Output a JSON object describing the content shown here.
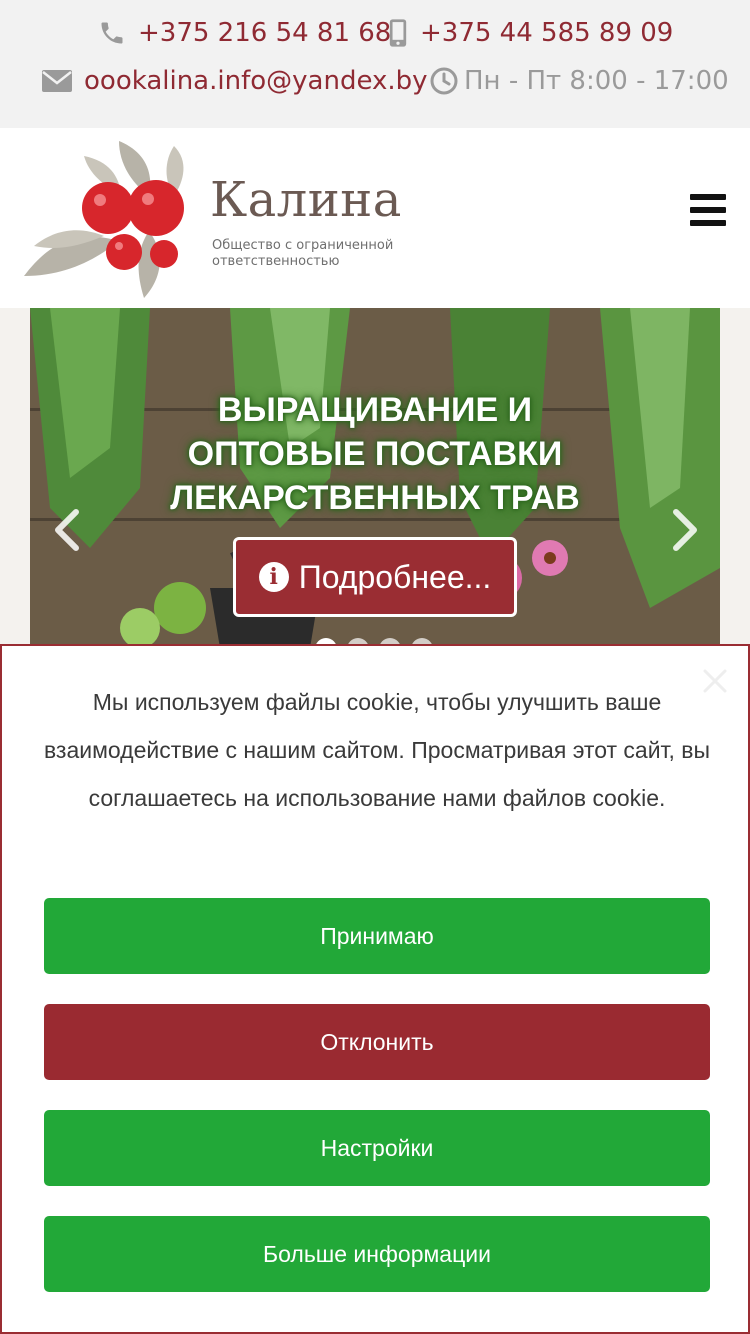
{
  "contacts": {
    "phone1": "+375 216 54 81 68",
    "phone2": "+375 44 585 89 09",
    "email": "oookalina.info@yandex.by",
    "hours": "Пн - Пт 8:00 - 17:00"
  },
  "icons": {
    "phone": "phone-icon",
    "mobile": "mobile-icon",
    "email": "envelope-icon",
    "hours": "clock-icon",
    "menu": "hamburger-icon"
  },
  "logo": {
    "title": "Калина",
    "subtitle": "Общество с ограниченной ответственностью"
  },
  "hero": {
    "title_line1": "ВЫРАЩИВАНИЕ И",
    "title_line2": "ОПТОВЫЕ ПОСТАВКИ",
    "title_line3": "ЛЕКАРСТВЕННЫХ ТРАВ",
    "button_label": "Подробнее...",
    "slide_count": 4,
    "active_slide": 1
  },
  "cookie": {
    "message": "Мы используем файлы cookie, чтобы улучшить ваше взаимодействие с нашим сайтом. Просматривая этот сайт, вы соглашаетесь на использование нами файлов cookie.",
    "accept_label": "Принимаю",
    "decline_label": "Отклонить",
    "settings_label": "Настройки",
    "more_label": "Больше информации"
  },
  "colors": {
    "brand_red": "#9a2d33",
    "accent_green": "#22a838",
    "topbar_bg": "#f2f2f2",
    "contact_text": "#8f2a33"
  }
}
